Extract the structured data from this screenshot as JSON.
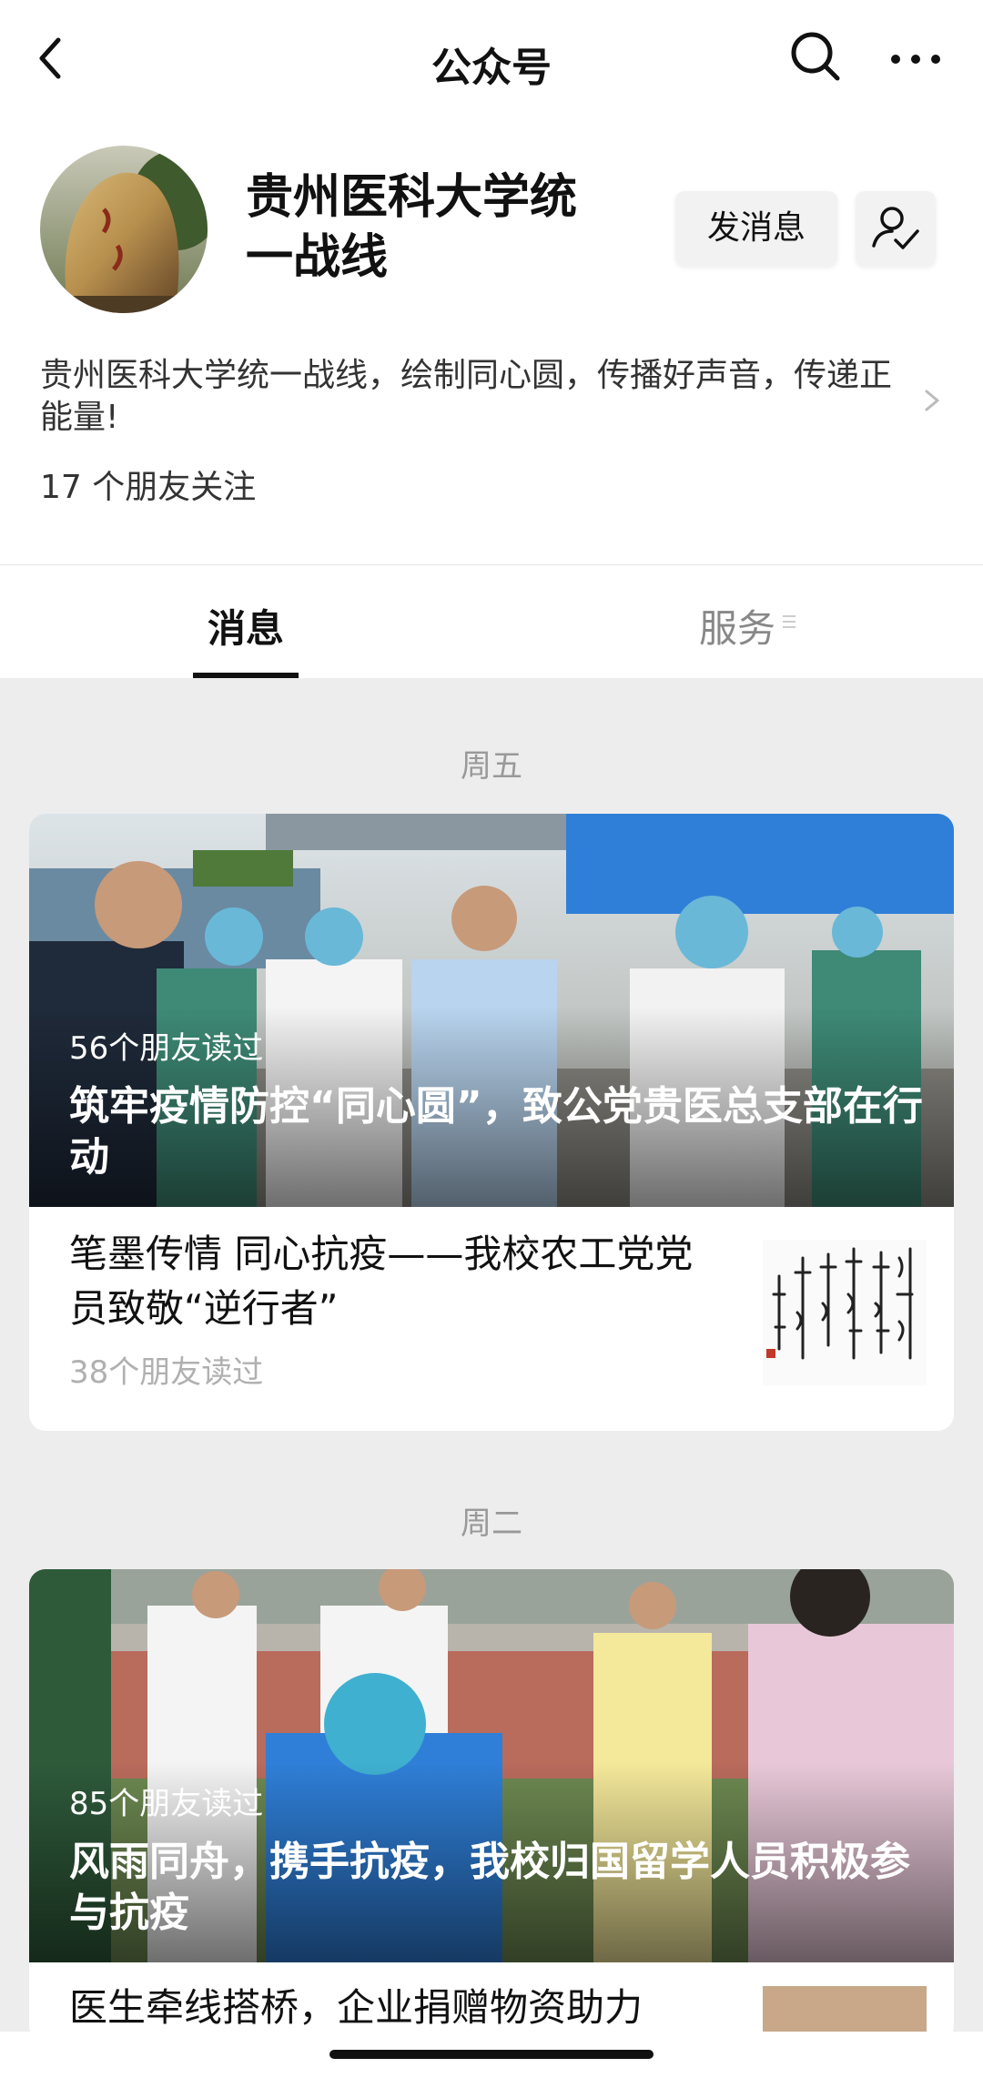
{
  "header": {
    "title": "公众号"
  },
  "profile": {
    "name": "贵州医科大学统一战线",
    "name_line1": "贵州医科大学统",
    "name_line2": "一战线",
    "message_button": "发消息",
    "description": "贵州医科大学统一战线，绘制同心圆，传播好声音，传递正能量!",
    "followers": "17 个朋友关注"
  },
  "tabs": {
    "messages": "消息",
    "services": "服务"
  },
  "feed": [
    {
      "date": "周五",
      "main": {
        "reads": "56个朋友读过",
        "title": "筑牢疫情防控“同心圆”，致公党贵医总支部在行动"
      },
      "sub": {
        "title": "笔墨传情 同心抗疫——我校农工党党员致敬“逆行者”",
        "reads": "38个朋友读过"
      }
    },
    {
      "date": "周二",
      "main": {
        "reads": "85个朋友读过",
        "title": "风雨同舟，携手抗疫，我校归国留学人员积极参与抗疫"
      },
      "sub": {
        "title": "医生牵线搭桥，企业捐赠物资助力"
      }
    }
  ],
  "colors": {
    "background": "#ededed",
    "surface": "#ffffff",
    "muted_text": "#999999"
  },
  "icons": {
    "back": "chevron-left-icon",
    "search": "search-icon",
    "more": "more-dots-icon",
    "follow": "user-check-icon",
    "menu": "menu-lines-icon"
  }
}
